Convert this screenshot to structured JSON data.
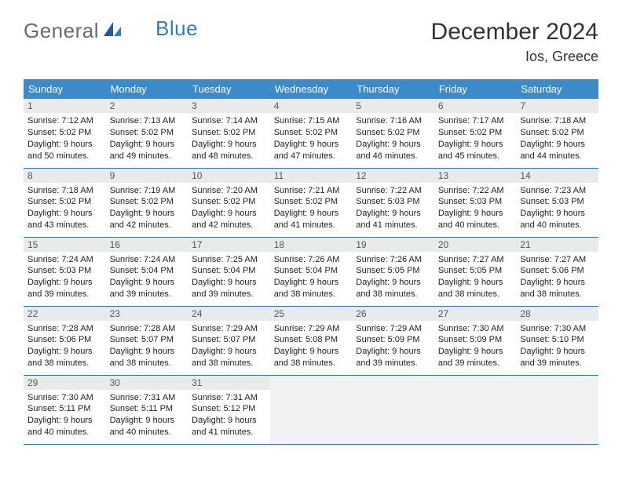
{
  "logo": {
    "part1": "General",
    "part2": "Blue"
  },
  "title": "December 2024",
  "location": "Ios, Greece",
  "weekdays": [
    "Sunday",
    "Monday",
    "Tuesday",
    "Wednesday",
    "Thursday",
    "Friday",
    "Saturday"
  ],
  "weeks": [
    [
      {
        "num": "1",
        "sunrise": "Sunrise: 7:12 AM",
        "sunset": "Sunset: 5:02 PM",
        "daylight": "Daylight: 9 hours and 50 minutes."
      },
      {
        "num": "2",
        "sunrise": "Sunrise: 7:13 AM",
        "sunset": "Sunset: 5:02 PM",
        "daylight": "Daylight: 9 hours and 49 minutes."
      },
      {
        "num": "3",
        "sunrise": "Sunrise: 7:14 AM",
        "sunset": "Sunset: 5:02 PM",
        "daylight": "Daylight: 9 hours and 48 minutes."
      },
      {
        "num": "4",
        "sunrise": "Sunrise: 7:15 AM",
        "sunset": "Sunset: 5:02 PM",
        "daylight": "Daylight: 9 hours and 47 minutes."
      },
      {
        "num": "5",
        "sunrise": "Sunrise: 7:16 AM",
        "sunset": "Sunset: 5:02 PM",
        "daylight": "Daylight: 9 hours and 46 minutes."
      },
      {
        "num": "6",
        "sunrise": "Sunrise: 7:17 AM",
        "sunset": "Sunset: 5:02 PM",
        "daylight": "Daylight: 9 hours and 45 minutes."
      },
      {
        "num": "7",
        "sunrise": "Sunrise: 7:18 AM",
        "sunset": "Sunset: 5:02 PM",
        "daylight": "Daylight: 9 hours and 44 minutes."
      }
    ],
    [
      {
        "num": "8",
        "sunrise": "Sunrise: 7:18 AM",
        "sunset": "Sunset: 5:02 PM",
        "daylight": "Daylight: 9 hours and 43 minutes."
      },
      {
        "num": "9",
        "sunrise": "Sunrise: 7:19 AM",
        "sunset": "Sunset: 5:02 PM",
        "daylight": "Daylight: 9 hours and 42 minutes."
      },
      {
        "num": "10",
        "sunrise": "Sunrise: 7:20 AM",
        "sunset": "Sunset: 5:02 PM",
        "daylight": "Daylight: 9 hours and 42 minutes."
      },
      {
        "num": "11",
        "sunrise": "Sunrise: 7:21 AM",
        "sunset": "Sunset: 5:02 PM",
        "daylight": "Daylight: 9 hours and 41 minutes."
      },
      {
        "num": "12",
        "sunrise": "Sunrise: 7:22 AM",
        "sunset": "Sunset: 5:03 PM",
        "daylight": "Daylight: 9 hours and 41 minutes."
      },
      {
        "num": "13",
        "sunrise": "Sunrise: 7:22 AM",
        "sunset": "Sunset: 5:03 PM",
        "daylight": "Daylight: 9 hours and 40 minutes."
      },
      {
        "num": "14",
        "sunrise": "Sunrise: 7:23 AM",
        "sunset": "Sunset: 5:03 PM",
        "daylight": "Daylight: 9 hours and 40 minutes."
      }
    ],
    [
      {
        "num": "15",
        "sunrise": "Sunrise: 7:24 AM",
        "sunset": "Sunset: 5:03 PM",
        "daylight": "Daylight: 9 hours and 39 minutes."
      },
      {
        "num": "16",
        "sunrise": "Sunrise: 7:24 AM",
        "sunset": "Sunset: 5:04 PM",
        "daylight": "Daylight: 9 hours and 39 minutes."
      },
      {
        "num": "17",
        "sunrise": "Sunrise: 7:25 AM",
        "sunset": "Sunset: 5:04 PM",
        "daylight": "Daylight: 9 hours and 39 minutes."
      },
      {
        "num": "18",
        "sunrise": "Sunrise: 7:26 AM",
        "sunset": "Sunset: 5:04 PM",
        "daylight": "Daylight: 9 hours and 38 minutes."
      },
      {
        "num": "19",
        "sunrise": "Sunrise: 7:26 AM",
        "sunset": "Sunset: 5:05 PM",
        "daylight": "Daylight: 9 hours and 38 minutes."
      },
      {
        "num": "20",
        "sunrise": "Sunrise: 7:27 AM",
        "sunset": "Sunset: 5:05 PM",
        "daylight": "Daylight: 9 hours and 38 minutes."
      },
      {
        "num": "21",
        "sunrise": "Sunrise: 7:27 AM",
        "sunset": "Sunset: 5:06 PM",
        "daylight": "Daylight: 9 hours and 38 minutes."
      }
    ],
    [
      {
        "num": "22",
        "sunrise": "Sunrise: 7:28 AM",
        "sunset": "Sunset: 5:06 PM",
        "daylight": "Daylight: 9 hours and 38 minutes."
      },
      {
        "num": "23",
        "sunrise": "Sunrise: 7:28 AM",
        "sunset": "Sunset: 5:07 PM",
        "daylight": "Daylight: 9 hours and 38 minutes."
      },
      {
        "num": "24",
        "sunrise": "Sunrise: 7:29 AM",
        "sunset": "Sunset: 5:07 PM",
        "daylight": "Daylight: 9 hours and 38 minutes."
      },
      {
        "num": "25",
        "sunrise": "Sunrise: 7:29 AM",
        "sunset": "Sunset: 5:08 PM",
        "daylight": "Daylight: 9 hours and 38 minutes."
      },
      {
        "num": "26",
        "sunrise": "Sunrise: 7:29 AM",
        "sunset": "Sunset: 5:09 PM",
        "daylight": "Daylight: 9 hours and 39 minutes."
      },
      {
        "num": "27",
        "sunrise": "Sunrise: 7:30 AM",
        "sunset": "Sunset: 5:09 PM",
        "daylight": "Daylight: 9 hours and 39 minutes."
      },
      {
        "num": "28",
        "sunrise": "Sunrise: 7:30 AM",
        "sunset": "Sunset: 5:10 PM",
        "daylight": "Daylight: 9 hours and 39 minutes."
      }
    ],
    [
      {
        "num": "29",
        "sunrise": "Sunrise: 7:30 AM",
        "sunset": "Sunset: 5:11 PM",
        "daylight": "Daylight: 9 hours and 40 minutes."
      },
      {
        "num": "30",
        "sunrise": "Sunrise: 7:31 AM",
        "sunset": "Sunset: 5:11 PM",
        "daylight": "Daylight: 9 hours and 40 minutes."
      },
      {
        "num": "31",
        "sunrise": "Sunrise: 7:31 AM",
        "sunset": "Sunset: 5:12 PM",
        "daylight": "Daylight: 9 hours and 41 minutes."
      },
      null,
      null,
      null,
      null
    ]
  ]
}
